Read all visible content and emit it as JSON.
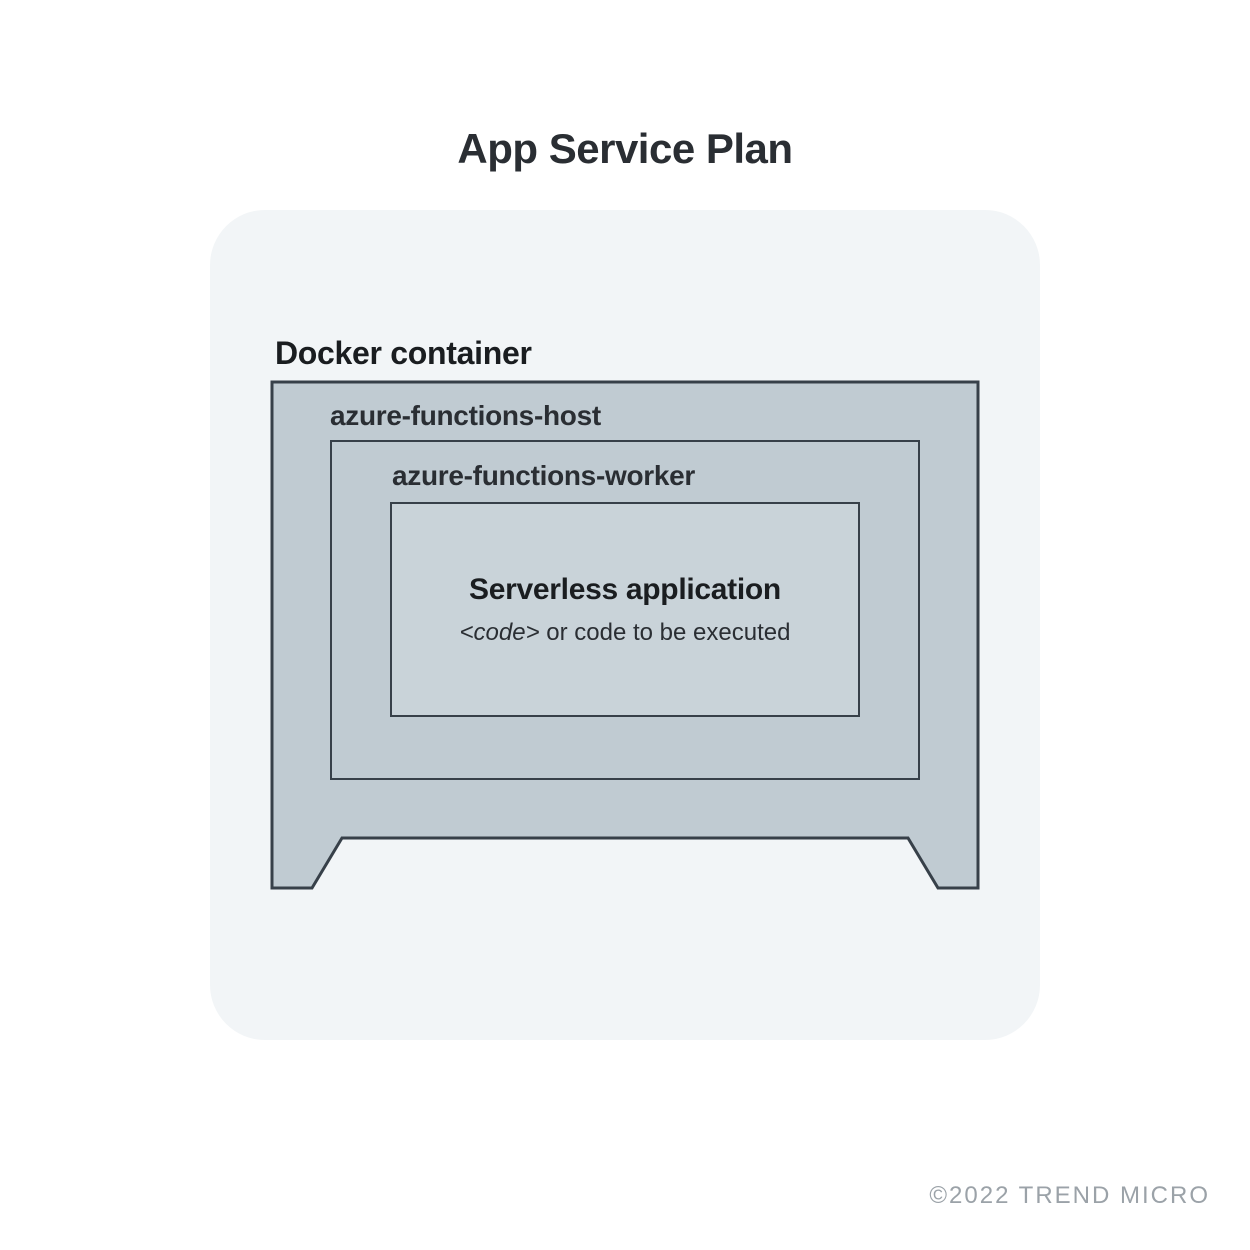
{
  "title": "App Service Plan",
  "docker_label": "Docker container",
  "host_label": "azure-functions-host",
  "worker_label": "azure-functions-worker",
  "app": {
    "title": "Serverless application",
    "code_prefix": "<code>",
    "subtitle_rest": " or code to be executed"
  },
  "copyright": "©2022 TREND MICRO",
  "colors": {
    "card_bg": "#f2f5f7",
    "monitor_fill": "#c0cbd2",
    "monitor_stroke": "#374049",
    "inner_fill": "#c9d3d9"
  }
}
